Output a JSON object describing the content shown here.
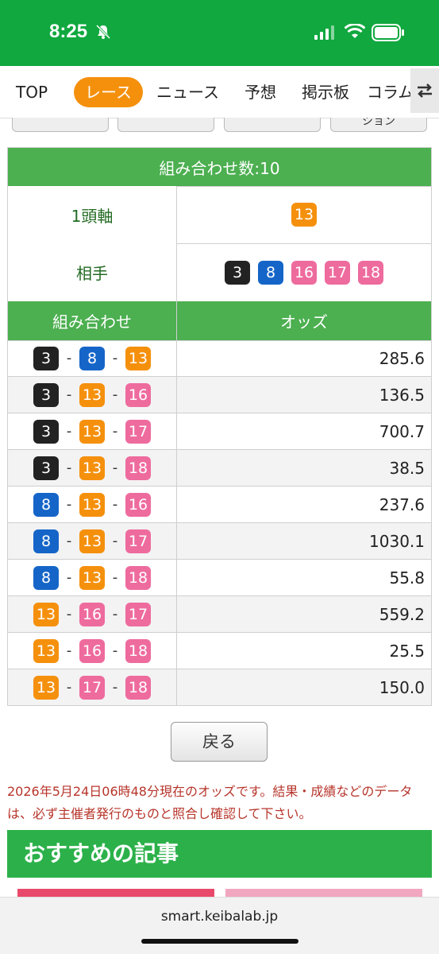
{
  "status": {
    "time": "8:25"
  },
  "nav": {
    "items": [
      "TOP",
      "レース",
      "ニュース",
      "予想",
      "掲示板",
      "コラム"
    ],
    "active_index": 1
  },
  "partial_buttons": [
    "",
    "",
    "",
    "ション"
  ],
  "summary": {
    "title": "組み合わせ数:10",
    "axis_label": "1頭軸",
    "axis_horse": "13",
    "partner_label": "相手",
    "partners": [
      "3",
      "8",
      "16",
      "17",
      "18"
    ]
  },
  "table": {
    "headers": [
      "組み合わせ",
      "オッズ"
    ],
    "rows": [
      {
        "combo": [
          "3",
          "8",
          "13"
        ],
        "odds": "285.6"
      },
      {
        "combo": [
          "3",
          "13",
          "16"
        ],
        "odds": "136.5"
      },
      {
        "combo": [
          "3",
          "13",
          "17"
        ],
        "odds": "700.7"
      },
      {
        "combo": [
          "3",
          "13",
          "18"
        ],
        "odds": "38.5"
      },
      {
        "combo": [
          "8",
          "13",
          "16"
        ],
        "odds": "237.6"
      },
      {
        "combo": [
          "8",
          "13",
          "17"
        ],
        "odds": "1030.1"
      },
      {
        "combo": [
          "8",
          "13",
          "18"
        ],
        "odds": "55.8"
      },
      {
        "combo": [
          "13",
          "16",
          "17"
        ],
        "odds": "559.2"
      },
      {
        "combo": [
          "13",
          "16",
          "18"
        ],
        "odds": "25.5"
      },
      {
        "combo": [
          "13",
          "17",
          "18"
        ],
        "odds": "150.0"
      }
    ]
  },
  "horse_colors": {
    "3": "#222222",
    "8": "#1565c8",
    "13": "#f5900d",
    "16": "#ee6b9e",
    "17": "#ee6b9e",
    "18": "#ee6b9e"
  },
  "back_label": "戻る",
  "note": "2026年5月24日06時48分現在のオッズです。結果・成績などのデータは、必ず主催者発行のものと照合し確認して下さい。",
  "recommend_title": "おすすめの記事",
  "url": "smart.keibalab.jp"
}
